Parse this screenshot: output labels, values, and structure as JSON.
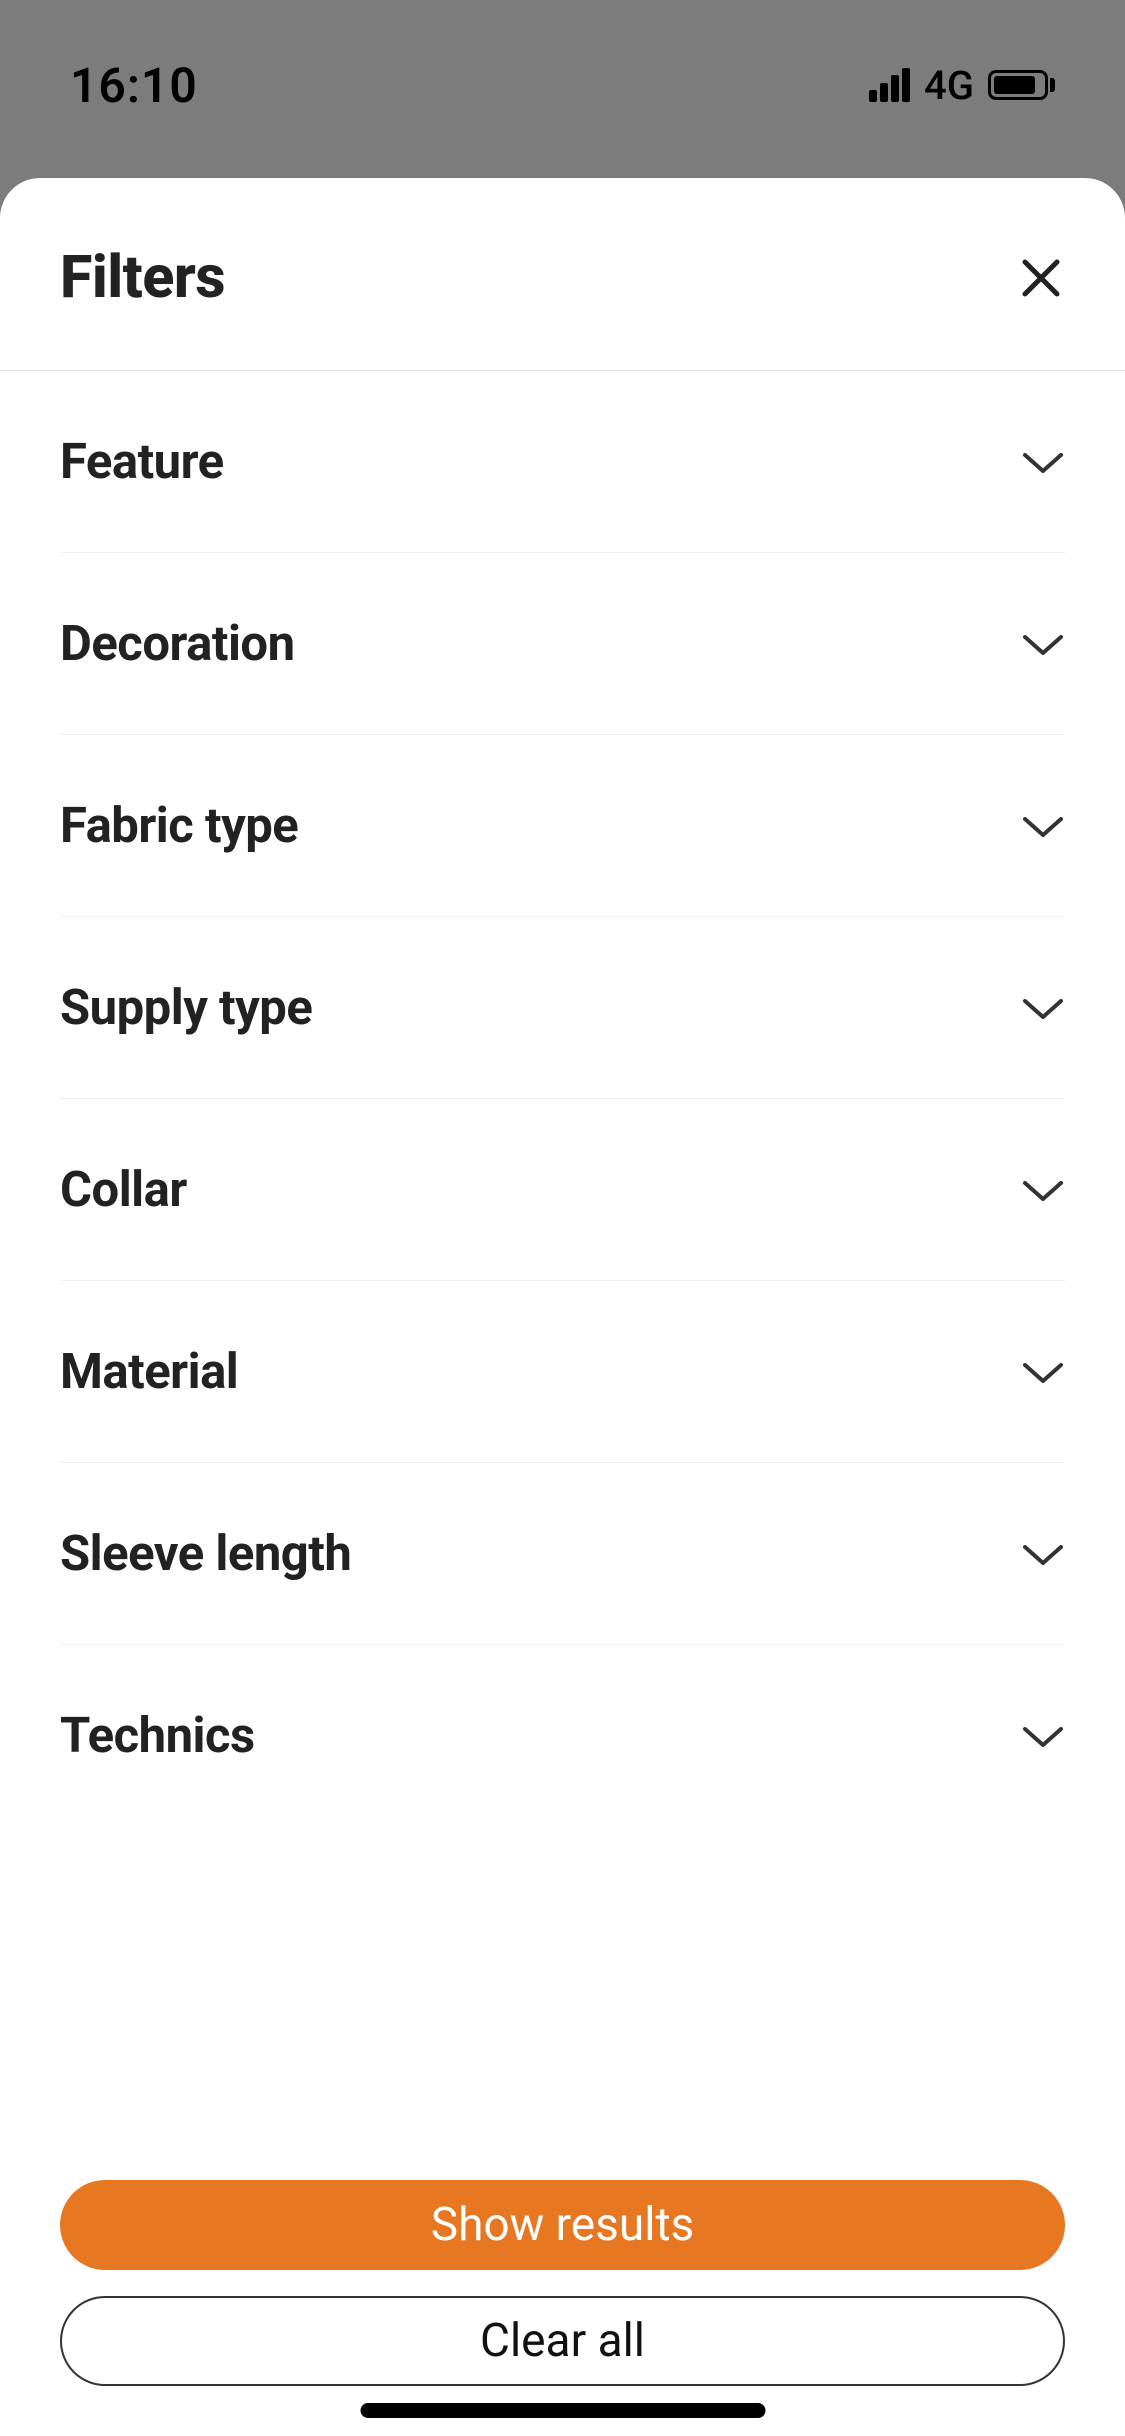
{
  "statusBar": {
    "time": "16:10",
    "network": "4G"
  },
  "modal": {
    "title": "Filters"
  },
  "filters": [
    {
      "label": "Feature"
    },
    {
      "label": "Decoration"
    },
    {
      "label": "Fabric type"
    },
    {
      "label": "Supply type"
    },
    {
      "label": "Collar"
    },
    {
      "label": "Material"
    },
    {
      "label": "Sleeve length"
    },
    {
      "label": "Technics"
    }
  ],
  "footer": {
    "primary": "Show results",
    "secondary": "Clear all"
  }
}
